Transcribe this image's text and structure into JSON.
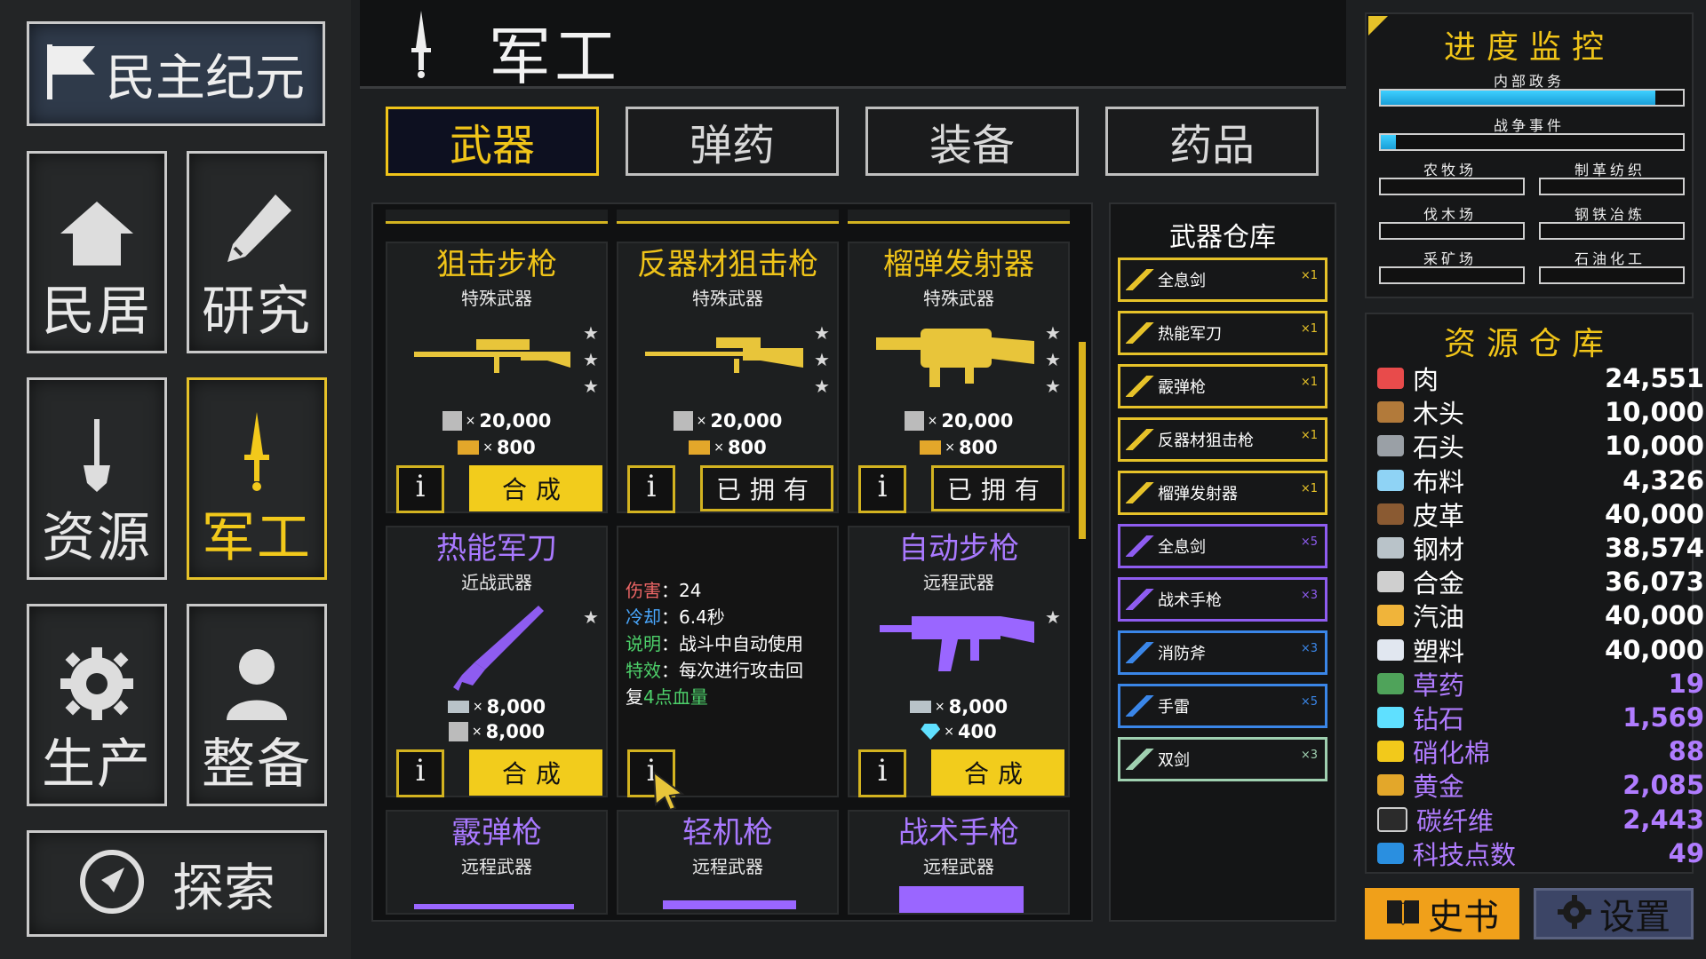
{
  "era": {
    "label": "民主纪元"
  },
  "nav": {
    "home": "民居",
    "research": "研究",
    "resources": "资源",
    "military": "军工",
    "production": "生产",
    "equip": "整备",
    "explore": "探索"
  },
  "header": {
    "title": "军工"
  },
  "tabs": [
    "武器",
    "弹药",
    "装备",
    "药品"
  ],
  "cards": [
    {
      "title": "狙击步枪",
      "sub": "特殊武器",
      "cost1": "20,000",
      "cost2": "800",
      "action": "合成"
    },
    {
      "title": "反器材狙击枪",
      "sub": "特殊武器",
      "cost1": "20,000",
      "cost2": "800",
      "action": "已拥有"
    },
    {
      "title": "榴弹发射器",
      "sub": "特殊武器",
      "cost1": "20,000",
      "cost2": "800",
      "action": "已拥有"
    },
    {
      "title": "热能军刀",
      "sub": "近战武器",
      "cost1": "8,000",
      "cost2": "8,000",
      "action": "合成"
    },
    {
      "title": "自动步枪",
      "sub": "远程武器",
      "cost1": "8,000",
      "cost2": "400",
      "action": "合成"
    },
    {
      "title": "霰弹枪",
      "sub": "远程武器"
    },
    {
      "title": "轻机枪",
      "sub": "远程武器"
    },
    {
      "title": "战术手枪",
      "sub": "远程武器"
    }
  ],
  "tooltip": {
    "dmg_label": "伤害",
    "dmg_val": "24",
    "cd_label": "冷却",
    "cd_val": "6.4秒",
    "desc_label": "说明",
    "desc_val": "战斗中自动使用",
    "fx_label": "特效",
    "fx_val": "每次进行攻击回",
    "fx_val2_pre": "复",
    "fx_val2_hl": "4点血量"
  },
  "info_glyph": "i",
  "times_glyph": "×",
  "warehouse": {
    "title": "武器仓库",
    "items": [
      {
        "name": "全息剑",
        "qty": "×1",
        "color": "#e6c229"
      },
      {
        "name": "热能军刀",
        "qty": "×1",
        "color": "#e6c229"
      },
      {
        "name": "霰弹枪",
        "qty": "×1",
        "color": "#e6c229"
      },
      {
        "name": "反器材狙击枪",
        "qty": "×1",
        "color": "#e6c229"
      },
      {
        "name": "榴弹发射器",
        "qty": "×1",
        "color": "#e6c229"
      },
      {
        "name": "全息剑",
        "qty": "×5",
        "color": "#8e5cf0"
      },
      {
        "name": "战术手枪",
        "qty": "×3",
        "color": "#8e5cf0"
      },
      {
        "name": "消防斧",
        "qty": "×3",
        "color": "#3a86e8"
      },
      {
        "name": "手雷",
        "qty": "×5",
        "color": "#3a86e8"
      },
      {
        "name": "双剑",
        "qty": "×3",
        "color": "#9fd0b0"
      }
    ]
  },
  "progress": {
    "title": "进度监控",
    "internal": "内部政务",
    "internal_value": 0.91,
    "war": "战争事件",
    "war_value": 0.05,
    "slots": [
      "农牧场",
      "制革纺织",
      "伐木场",
      "钢铁冶炼",
      "采矿场",
      "石油化工"
    ]
  },
  "resources": {
    "title": "资源仓库",
    "items": [
      {
        "name": "肉",
        "value": "24,551",
        "color": "#ffffff",
        "icon": "meat-icon"
      },
      {
        "name": "木头",
        "value": "10,000",
        "color": "#ffffff",
        "icon": "wood-icon"
      },
      {
        "name": "石头",
        "value": "10,000",
        "color": "#ffffff",
        "icon": "stone-icon"
      },
      {
        "name": "布料",
        "value": "4,326",
        "color": "#ffffff",
        "icon": "cloth-icon"
      },
      {
        "name": "皮革",
        "value": "40,000",
        "color": "#ffffff",
        "icon": "leather-icon"
      },
      {
        "name": "钢材",
        "value": "38,574",
        "color": "#ffffff",
        "icon": "steel-icon"
      },
      {
        "name": "合金",
        "value": "36,073",
        "color": "#ffffff",
        "icon": "alloy-icon"
      },
      {
        "name": "汽油",
        "value": "40,000",
        "color": "#ffffff",
        "icon": "gasoline-icon"
      },
      {
        "name": "塑料",
        "value": "40,000",
        "color": "#ffffff",
        "icon": "plastic-icon"
      },
      {
        "name": "草药",
        "value": "19",
        "color": "#b07cff",
        "icon": "herb-icon"
      },
      {
        "name": "钻石",
        "value": "1,569",
        "color": "#b07cff",
        "icon": "diamond-icon"
      },
      {
        "name": "硝化棉",
        "value": "88",
        "color": "#b07cff",
        "icon": "nitrocellulose-icon"
      },
      {
        "name": "黄金",
        "value": "2,085",
        "color": "#b07cff",
        "icon": "gold-icon"
      },
      {
        "name": "碳纤维",
        "value": "2,443",
        "color": "#b07cff",
        "icon": "carbon-fiber-icon"
      },
      {
        "name": "科技点数",
        "value": "49",
        "color": "#b07cff",
        "icon": "tech-points-icon"
      }
    ]
  },
  "footer": {
    "history": "史书",
    "settings": "设置"
  }
}
